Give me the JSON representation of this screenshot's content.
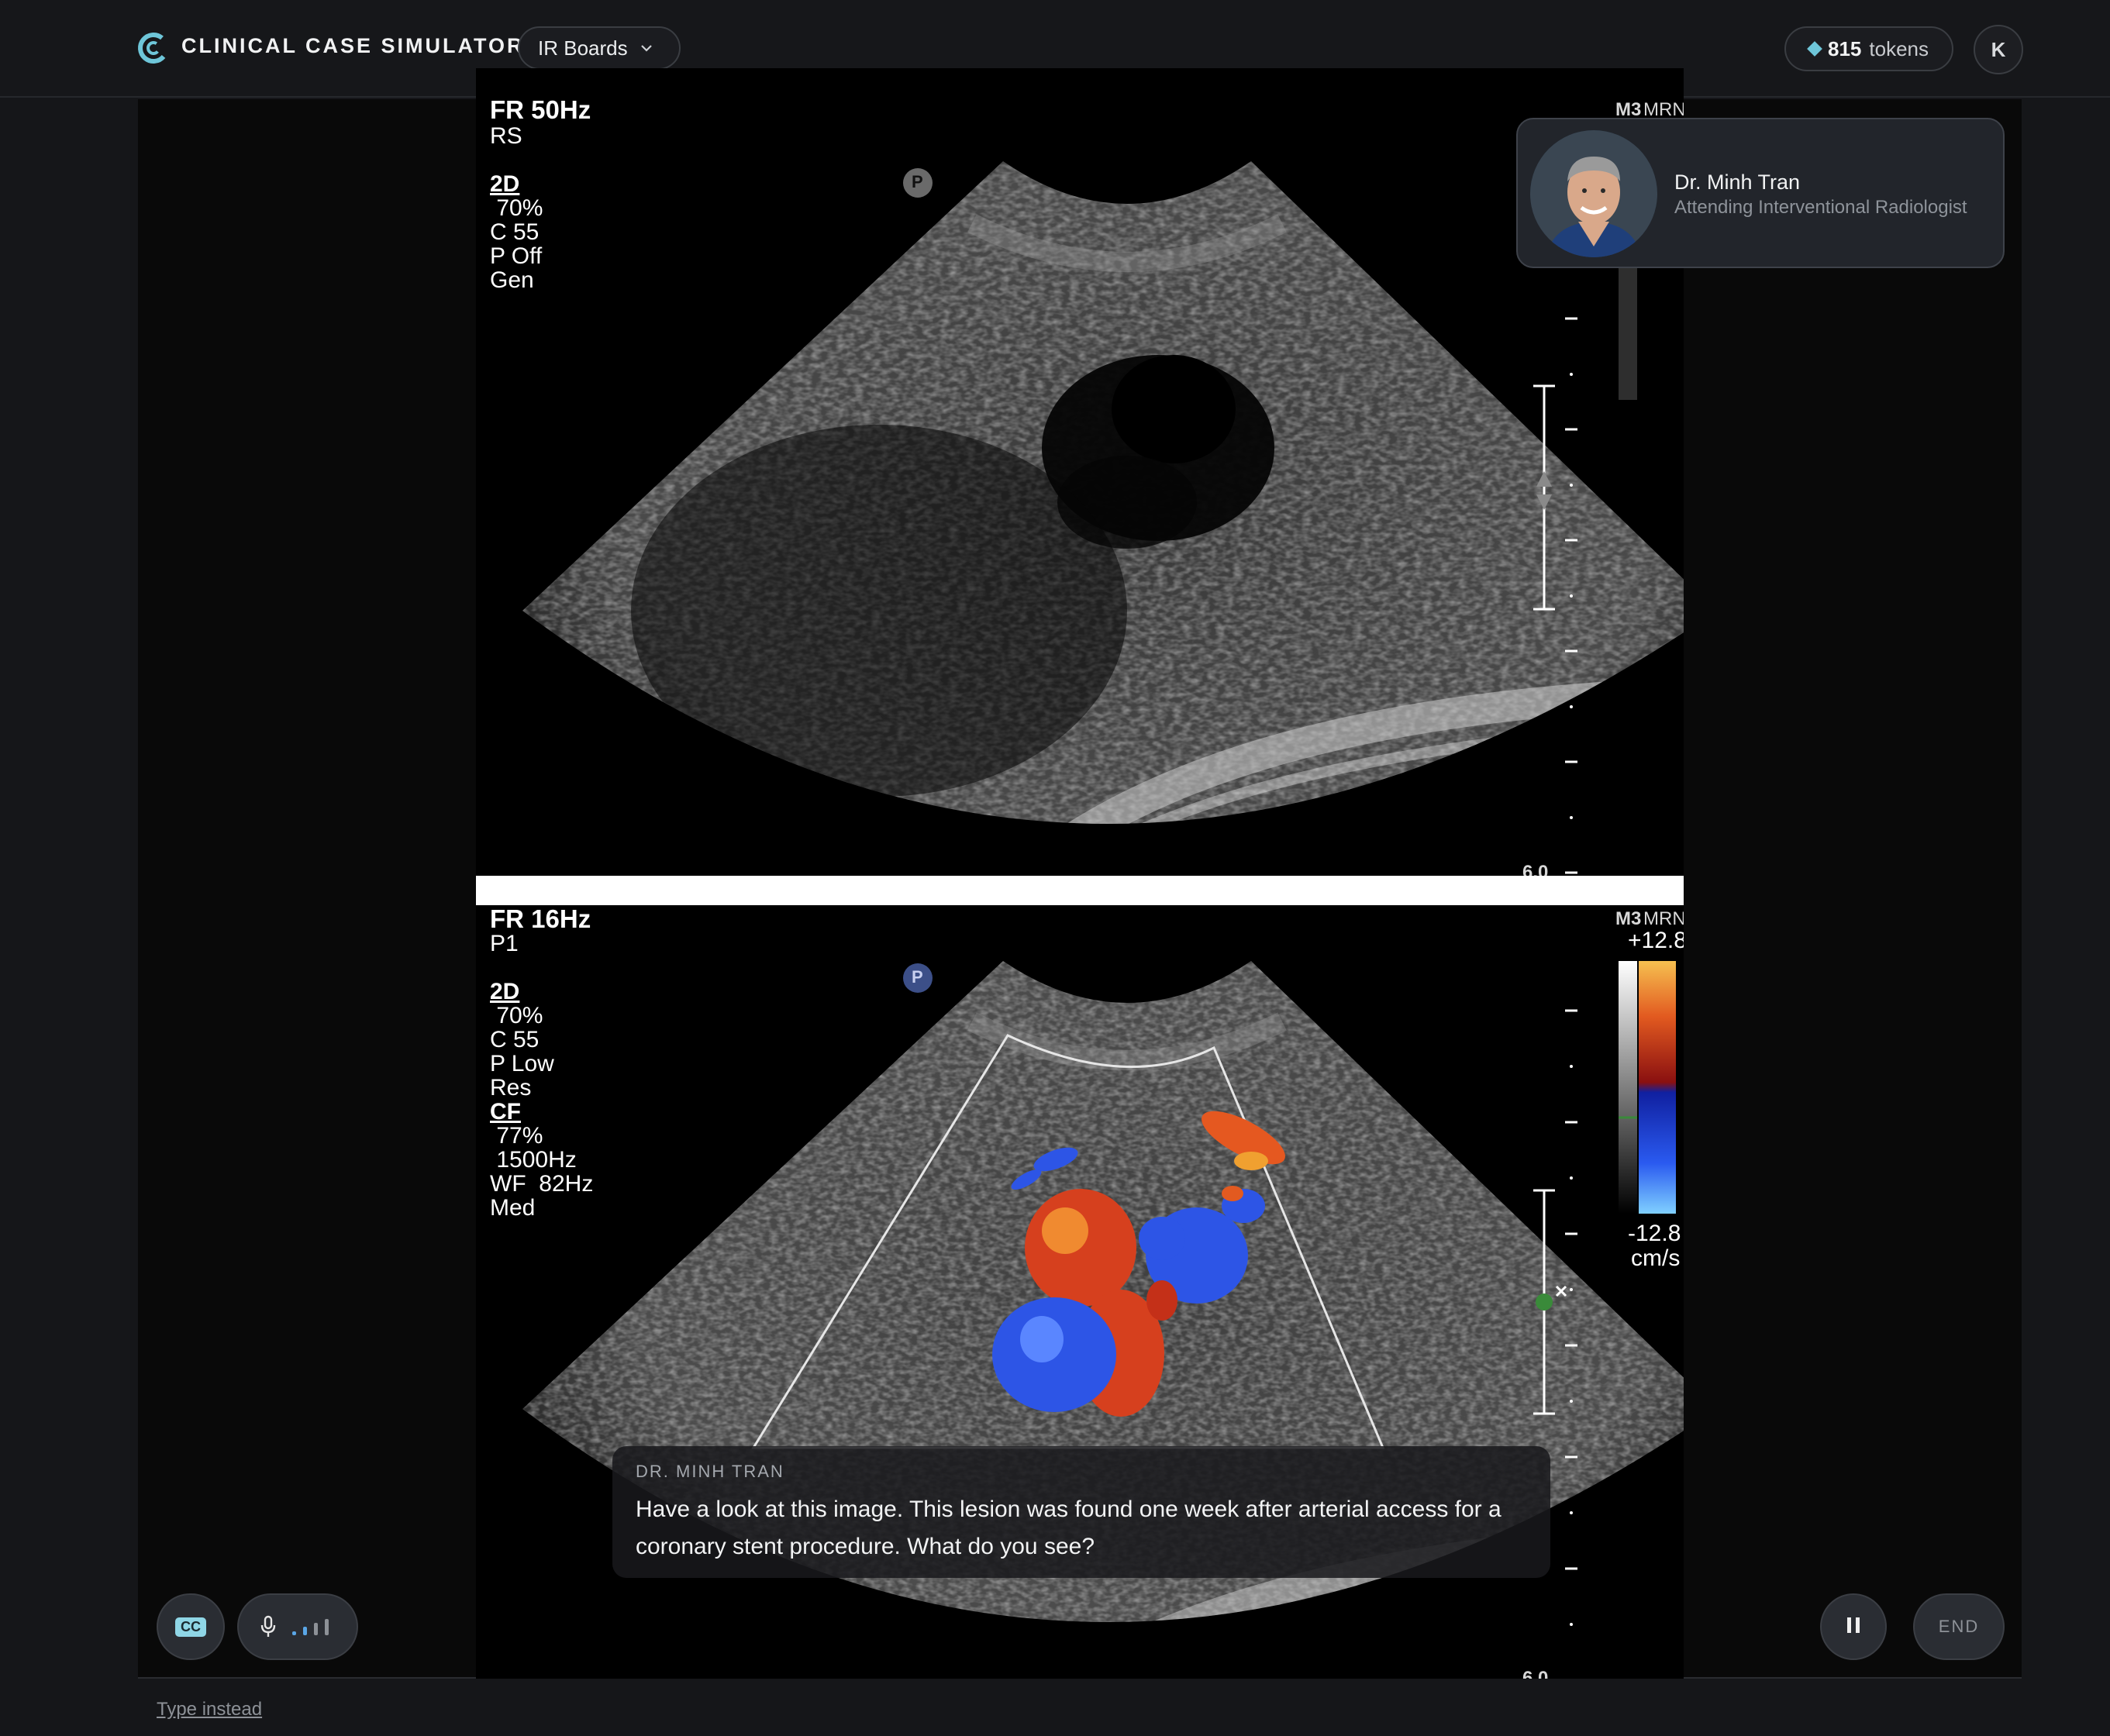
{
  "header": {
    "app_title": "CLINICAL CASE SIMULATOR",
    "deck_label": "IR Boards",
    "tokens_count": "815",
    "tokens_unit": "tokens",
    "user_initial": "K"
  },
  "attending": {
    "name": "Dr. Minh Tran",
    "role": "Attending Interventional Radiologist"
  },
  "ultrasound_top": {
    "frame_rate": "FR 50Hz",
    "preset": "RS",
    "mode": "2D",
    "gain": " 70%",
    "contrast": "C 55",
    "persistence": "P Off",
    "freq": "Gen",
    "mi_label": "M3",
    "mrn_label": "MRN:",
    "probe_marker": "P",
    "depth_label": "6.0"
  },
  "ultrasound_bottom": {
    "frame_rate": "FR 16Hz",
    "preset": "P1",
    "mode": "2D",
    "gain": " 70%",
    "contrast": "C 55",
    "persistence": "P Low",
    "freq": "Res",
    "color_mode": "CF",
    "cf_gain": " 77%",
    "prf": " 1500Hz",
    "wall_filter": "WF  82Hz",
    "cf_freq": "Med",
    "mi_label": "M3",
    "mrn_label": "MRN:",
    "probe_marker": "P",
    "scale_max": "+12.8",
    "scale_min": "-12.8",
    "scale_unit": "cm/s",
    "depth_label": "6.0"
  },
  "subtitle": {
    "speaker": "DR. MINH TRAN",
    "text": "Have a look at this image. This lesion was found one week after arterial access for a coronary stent procedure. What do you see?"
  },
  "controls": {
    "cc_label": "CC",
    "end_label": "END",
    "type_instead": "Type instead"
  },
  "colors": {
    "accent": "#6ec6d9",
    "background": "#151619",
    "doppler_red": "#d8341e",
    "doppler_blue": "#2d55e6"
  },
  "icons": {
    "logo": "c-logo-icon",
    "deck_chevron": "chevron-down-icon",
    "tokens": "diamond-icon",
    "mic": "microphone-icon",
    "pause": "pause-icon"
  }
}
